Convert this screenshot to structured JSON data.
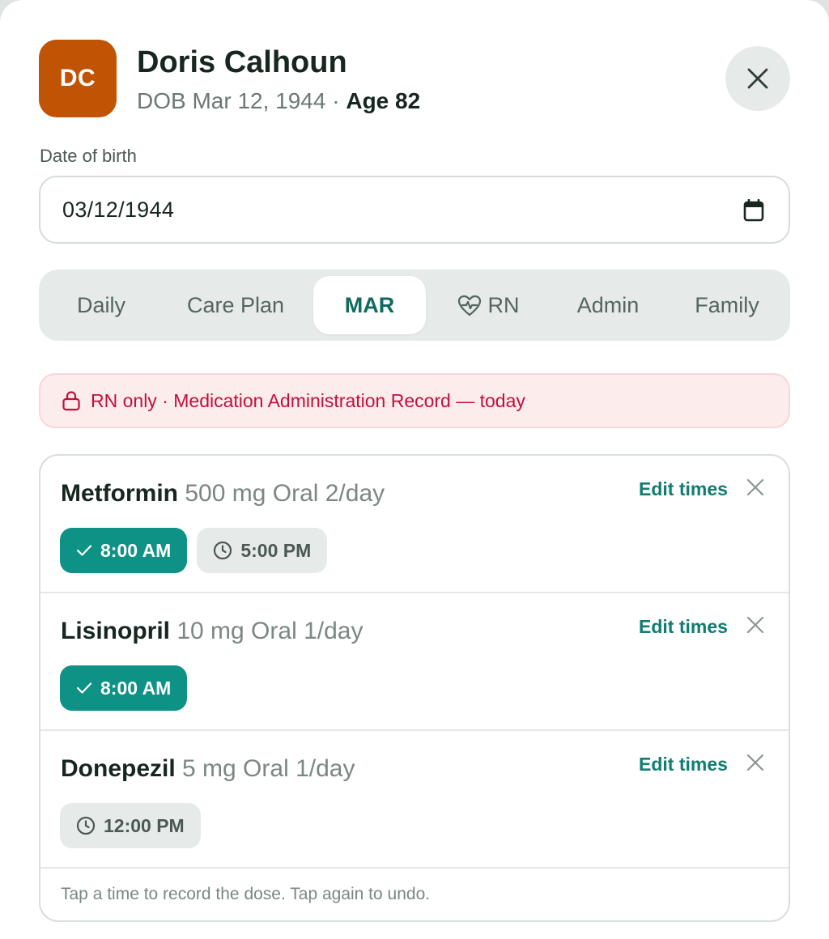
{
  "patient": {
    "initials": "DC",
    "name": "Doris Calhoun",
    "dob_prefix": "DOB Mar 12, 1944 · ",
    "age": "Age 82",
    "avatar_color": "#c05404"
  },
  "dob_field": {
    "label": "Date of birth",
    "value": "03/12/1944"
  },
  "tabs": [
    {
      "label": "Daily",
      "active": false
    },
    {
      "label": "Care Plan",
      "active": false
    },
    {
      "label": "MAR",
      "active": true
    },
    {
      "label": "RN",
      "active": false,
      "icon": "heart-pulse-icon"
    },
    {
      "label": "Admin",
      "active": false
    },
    {
      "label": "Family",
      "active": false
    }
  ],
  "notice": {
    "icon": "lock-icon",
    "text": "RN only · Medication Administration Record — today"
  },
  "medications": [
    {
      "name": "Metformin",
      "detail": "500 mg Oral 2/day",
      "edit_label": "Edit times",
      "doses": [
        {
          "time": "8:00 AM",
          "status": "given"
        },
        {
          "time": "5:00 PM",
          "status": "due"
        }
      ]
    },
    {
      "name": "Lisinopril",
      "detail": "10 mg Oral 1/day",
      "edit_label": "Edit times",
      "doses": [
        {
          "time": "8:00 AM",
          "status": "given"
        }
      ]
    },
    {
      "name": "Donepezil",
      "detail": "5 mg Oral 1/day",
      "edit_label": "Edit times",
      "doses": [
        {
          "time": "12:00 PM",
          "status": "due"
        }
      ]
    }
  ],
  "footnote": "Tap a time to record the dose. Tap again to undo.",
  "colors": {
    "accent": "#0f9286",
    "alert": "#c2103a"
  }
}
